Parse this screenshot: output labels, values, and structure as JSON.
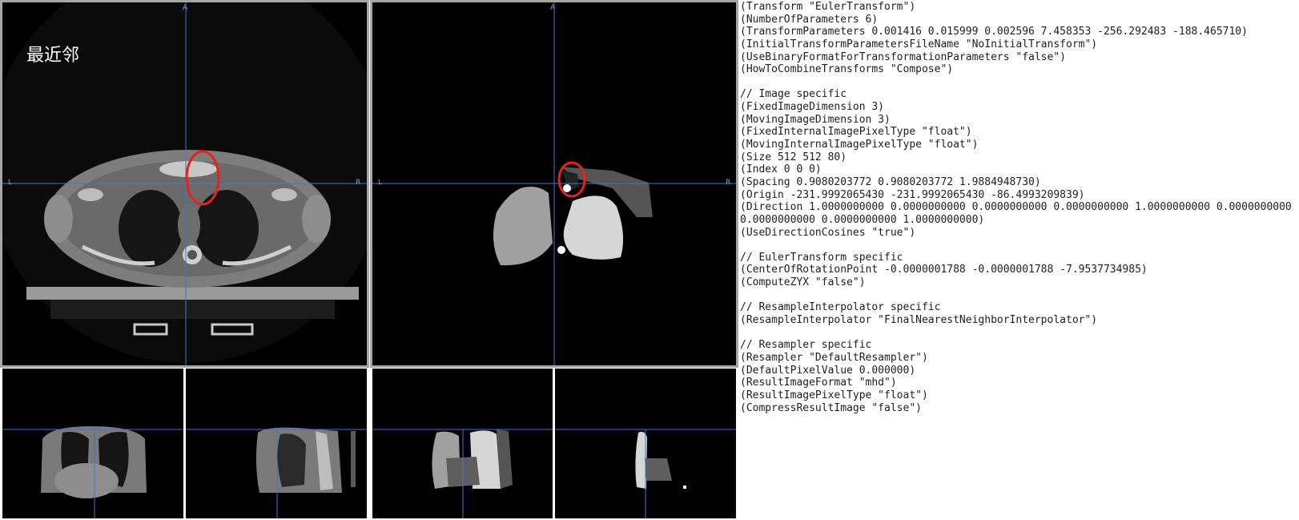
{
  "viewer": {
    "method_label": "最近邻",
    "orientation": {
      "left": "L",
      "right": "R",
      "top": "A"
    },
    "colors": {
      "crosshair": "#3a78d8",
      "highlight_circle": "#e8221a",
      "background": "#000000"
    }
  },
  "param_file": {
    "lines": [
      "(Transform \"EulerTransform\")",
      "(NumberOfParameters 6)",
      "(TransformParameters 0.001416 0.015999 0.002596 7.458353 -256.292483 -188.465710)",
      "(InitialTransformParametersFileName \"NoInitialTransform\")",
      "(UseBinaryFormatForTransformationParameters \"false\")",
      "(HowToCombineTransforms \"Compose\")",
      "",
      "// Image specific",
      "(FixedImageDimension 3)",
      "(MovingImageDimension 3)",
      "(FixedInternalImagePixelType \"float\")",
      "(MovingInternalImagePixelType \"float\")",
      "(Size 512 512 80)",
      "(Index 0 0 0)",
      "(Spacing 0.9080203772 0.9080203772 1.9884948730)",
      "(Origin -231.9992065430 -231.9992065430 -86.4993209839)",
      "(Direction 1.0000000000 0.0000000000 0.0000000000 0.0000000000 1.0000000000 0.0000000000 0.0000000000",
      "0.0000000000 0.0000000000 1.0000000000)",
      "(UseDirectionCosines \"true\")",
      "",
      "// EulerTransform specific",
      "(CenterOfRotationPoint -0.0000001788 -0.0000001788 -7.9537734985)",
      "(ComputeZYX \"false\")",
      "",
      "// ResampleInterpolator specific",
      "(ResampleInterpolator \"FinalNearestNeighborInterpolator\")",
      "",
      "// Resampler specific",
      "(Resampler \"DefaultResampler\")",
      "(DefaultPixelValue 0.000000)",
      "(ResultImageFormat \"mhd\")",
      "(ResultImagePixelType \"float\")",
      "(CompressResultImage \"false\")"
    ]
  }
}
